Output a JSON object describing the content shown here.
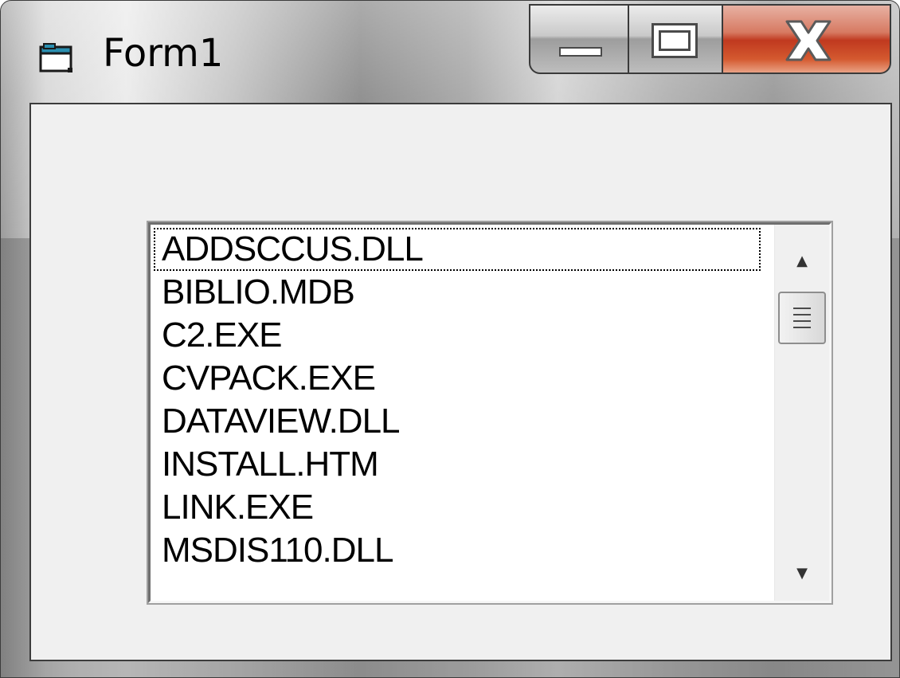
{
  "window": {
    "title": "Form1",
    "icon": "form-window-icon",
    "controls": [
      "minimize-icon",
      "maximize-icon",
      "close-icon"
    ]
  },
  "listbox": {
    "items": [
      "ADDSCCUS.DLL",
      "BIBLIO.MDB",
      "C2.EXE",
      "CVPACK.EXE",
      "DATAVIEW.DLL",
      "INSTALL.HTM",
      "LINK.EXE",
      "MSDIS110.DLL"
    ],
    "focused_index": 0,
    "scrollbar": {
      "up_arrow": "▲",
      "down_arrow": "▼"
    }
  },
  "colors": {
    "client_background": "#f0f0f0",
    "list_background": "#ffffff",
    "close_button": "#c0391f"
  }
}
